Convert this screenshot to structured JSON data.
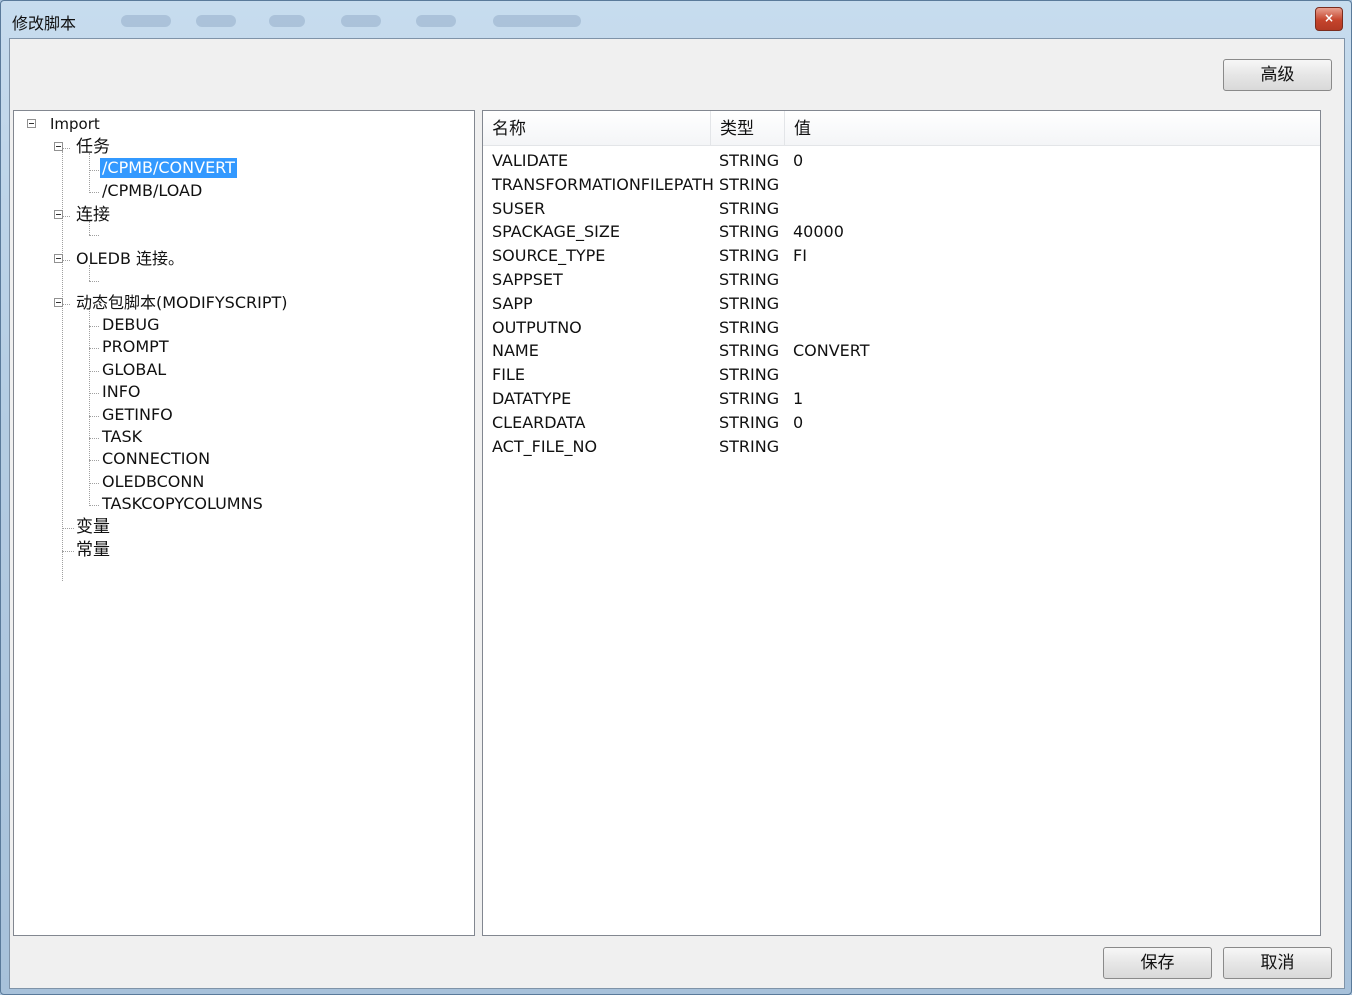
{
  "window": {
    "title": "修改脚本",
    "close_label": "×"
  },
  "buttons": {
    "advanced": "高级",
    "save": "保存",
    "cancel": "取消"
  },
  "tree": {
    "root": "Import",
    "task": "任务",
    "task_items": [
      "/CPMB/CONVERT",
      "/CPMB/LOAD"
    ],
    "connection": "连接",
    "oledb": "OLEDB 连接。",
    "dynamic": "动态包脚本(MODIFYSCRIPT)",
    "dynamic_items": [
      "DEBUG",
      "PROMPT",
      "GLOBAL",
      "INFO",
      "GETINFO",
      "TASK",
      "CONNECTION",
      "OLEDBCONN",
      "TASKCOPYCOLUMNS"
    ],
    "variables": "变量",
    "constants": "常量",
    "selected": "/CPMB/CONVERT"
  },
  "list": {
    "columns": [
      "名称",
      "类型",
      "值"
    ],
    "rows": [
      [
        "VALIDATE",
        "STRING",
        "0"
      ],
      [
        "TRANSFORMATIONFILEPATH",
        "STRING",
        ""
      ],
      [
        "SUSER",
        "STRING",
        ""
      ],
      [
        "SPACKAGE_SIZE",
        "STRING",
        "40000"
      ],
      [
        "SOURCE_TYPE",
        "STRING",
        "FI"
      ],
      [
        "SAPPSET",
        "STRING",
        ""
      ],
      [
        "SAPP",
        "STRING",
        ""
      ],
      [
        "OUTPUTNO",
        "STRING",
        ""
      ],
      [
        "NAME",
        "STRING",
        "CONVERT"
      ],
      [
        "FILE",
        "STRING",
        ""
      ],
      [
        "DATATYPE",
        "STRING",
        "1"
      ],
      [
        "CLEARDATA",
        "STRING",
        "0"
      ],
      [
        "ACT_FILE_NO",
        "STRING",
        ""
      ]
    ]
  },
  "colors": {
    "selection": "#3399ff",
    "title_gradient": "#b5cde3",
    "close_button": "#c5442c"
  }
}
